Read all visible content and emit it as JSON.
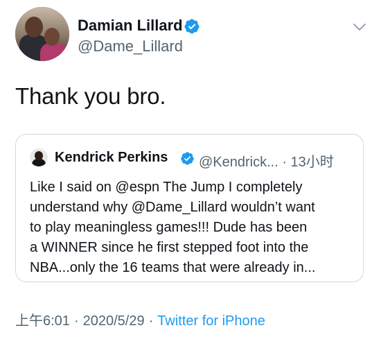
{
  "author": {
    "name": "Damian Lillard",
    "handle": "@Dame_Lillard",
    "verified": true
  },
  "tweet": {
    "text": "Thank you bro."
  },
  "quoted_tweet": {
    "name": "Kendrick Perkins",
    "handle": "@Kendrick...",
    "time": "13小时",
    "meta": "@Kendrick... · 13小时",
    "lines": [
      "Like I said on @espn The Jump I completely",
      "understand why @Dame_Lillard wouldn’t want",
      "to play meaningless games!!! Dude has been",
      "a WINNER since he first stepped foot into the",
      "NBA...only the 16 teams that were already in..."
    ]
  },
  "footer": {
    "time": "上午6:01",
    "separator": "·",
    "date": "2020/5/29",
    "source": "Twitter for iPhone"
  },
  "icons": {
    "verified": "verified-badge-icon",
    "chevron": "chevron-down-icon"
  },
  "colors": {
    "text": "#0f1419",
    "secondary": "#536471",
    "accent": "#1d9bf0",
    "border": "#cfd9de"
  }
}
